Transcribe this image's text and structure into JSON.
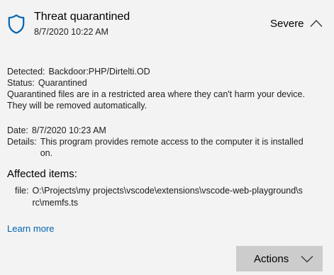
{
  "header": {
    "title": "Threat quarantined",
    "timestamp": "8/7/2020 10:22 AM",
    "severity": "Severe"
  },
  "info": {
    "detected_label": "Detected:",
    "detected_value": "Backdoor:PHP/Dirtelti.OD",
    "status_label": "Status:",
    "status_value": "Quarantined",
    "description_line1": "Quarantined files are in a restricted area where they can't harm your device.",
    "description_line2": "They will be removed automatically.",
    "date_label": "Date:",
    "date_value": "8/7/2020 10:23 AM",
    "details_label": "Details:",
    "details_value": "This program provides remote access to the computer it is installed on."
  },
  "affected": {
    "title": "Affected items:",
    "file_label": "file:",
    "file_path": "O:\\Projects\\my projects\\vscode\\extensions\\vscode-web-playground\\src\\memfs.ts"
  },
  "links": {
    "learn_more": "Learn more"
  },
  "actions": {
    "label": "Actions"
  },
  "colors": {
    "background": "#f3f3f3",
    "shield": "#0063b1",
    "link": "#0063b1",
    "button": "#cccccc"
  },
  "icons": {
    "shield": "shield-icon",
    "collapse": "chevron-up-icon",
    "dropdown": "chevron-down-icon"
  }
}
